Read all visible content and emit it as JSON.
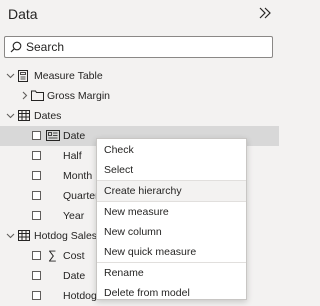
{
  "pane": {
    "title": "Data"
  },
  "search": {
    "placeholder": "Search"
  },
  "tree": {
    "measure_table": {
      "label": "Measure Table",
      "children": [
        {
          "label": "Gross Margin"
        }
      ]
    },
    "dates": {
      "label": "Dates",
      "fields": [
        {
          "label": "Date"
        },
        {
          "label": "Half"
        },
        {
          "label": "Month"
        },
        {
          "label": "Quarter"
        },
        {
          "label": "Year"
        }
      ]
    },
    "hotdog_sales": {
      "label": "Hotdog Sales",
      "fields": [
        {
          "label": "Cost"
        },
        {
          "label": "Date"
        },
        {
          "label": "Hotdog"
        }
      ]
    }
  },
  "context_menu": {
    "items": [
      {
        "label": "Check"
      },
      {
        "label": "Select"
      },
      {
        "label": "Create hierarchy"
      },
      {
        "label": "New measure"
      },
      {
        "label": "New column"
      },
      {
        "label": "New quick measure"
      },
      {
        "label": "Rename"
      },
      {
        "label": "Delete from model"
      }
    ]
  }
}
